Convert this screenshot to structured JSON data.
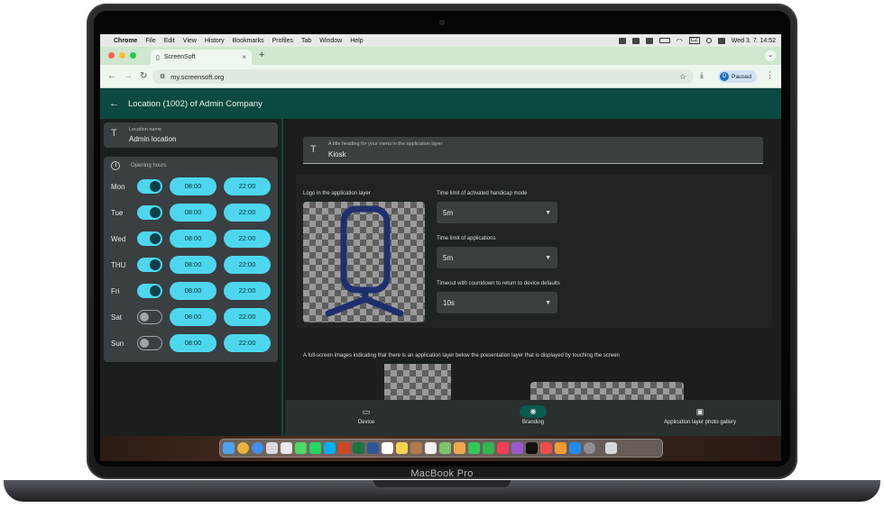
{
  "device": {
    "brand_label": "MacBook Pro"
  },
  "menubar": {
    "items": [
      "Chrome",
      "File",
      "Edit",
      "View",
      "History",
      "Bookmarks",
      "Profiles",
      "Tab",
      "Window",
      "Help"
    ],
    "input_source": "CZ",
    "clock": "Wed 3. 7.  14:52"
  },
  "browser": {
    "tab_title": "ScreenSoft",
    "url": "my.screensoft.org",
    "profile_initial": "D",
    "profile_status": "Paused"
  },
  "app": {
    "header_title": "Location (1002) of  Admin Company",
    "location_field": {
      "label": "Location name",
      "value": "Admin location"
    },
    "opening_hours": {
      "label": "Opening hours",
      "days": [
        {
          "day": "Mon",
          "open": "08:00",
          "close": "22:00",
          "enabled": true
        },
        {
          "day": "Tue",
          "open": "08:00",
          "close": "22:00",
          "enabled": true
        },
        {
          "day": "Wed",
          "open": "08:00",
          "close": "22:00",
          "enabled": true
        },
        {
          "day": "THU",
          "open": "08:00",
          "close": "22:00",
          "enabled": true
        },
        {
          "day": "Fri",
          "open": "08:00",
          "close": "22:00",
          "enabled": true
        },
        {
          "day": "Sat",
          "open": "08:00",
          "close": "22:00",
          "enabled": false
        },
        {
          "day": "Sun",
          "open": "08:00",
          "close": "22:00",
          "enabled": false
        }
      ]
    },
    "title_field": {
      "label": "A title heading for your menu in the application layer",
      "value": "Kiosk"
    },
    "logo_label": "Logo in the application layer",
    "selects": [
      {
        "label": "Time limit of activated handicap mode",
        "value": "5m"
      },
      {
        "label": "Time limit of applications",
        "value": "5m"
      },
      {
        "label": "Timeout with countdown to return to device defaults",
        "value": "10s"
      }
    ],
    "fullscreen_label": "A full-screen images indicating that there is an application layer below the presentation layer that is displayed by touching the screen",
    "bottom_nav": [
      {
        "label": "Device",
        "icon": "devices-icon",
        "active": false
      },
      {
        "label": "Branding",
        "icon": "palette-icon",
        "active": true
      },
      {
        "label": "Application layer photo gallery",
        "icon": "image-icon",
        "active": false
      }
    ]
  },
  "colors": {
    "accent": "#4dd7ee",
    "app_header": "#0b4a40",
    "panel": "#3a3f41"
  }
}
